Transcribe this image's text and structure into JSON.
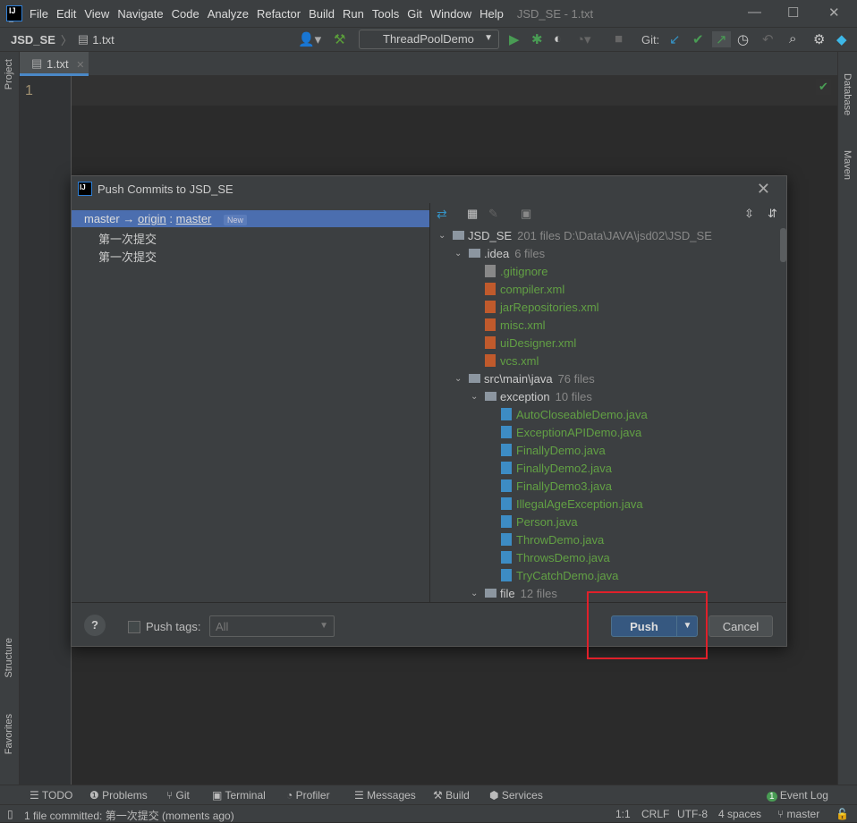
{
  "titlebar": {
    "menu": [
      "File",
      "Edit",
      "View",
      "Navigate",
      "Code",
      "Analyze",
      "Refactor",
      "Build",
      "Run",
      "Tools",
      "Git",
      "Window",
      "Help"
    ],
    "title": "JSD_SE - 1.txt"
  },
  "toolbar": {
    "project": "JSD_SE",
    "file": "1.txt",
    "run_config": "ThreadPoolDemo",
    "git_label": "Git:"
  },
  "side": {
    "left_top": "Project",
    "left_structure": "Structure",
    "left_favorites": "Favorites",
    "right_database": "Database",
    "right_maven": "Maven"
  },
  "editor": {
    "tab": "1.txt",
    "line": "1"
  },
  "dialog": {
    "title": "Push Commits to JSD_SE",
    "branch": {
      "local": "master",
      "arrow": "→",
      "remote": "origin",
      "sep": ":",
      "target": "master",
      "badge": "New"
    },
    "commits": [
      "第一次提交",
      "第一次提交"
    ],
    "tree": [
      {
        "level": 0,
        "type": "folder",
        "name": "JSD_SE",
        "info": "201 files  D:\\Data\\JAVA\\jsd02\\JSD_SE",
        "expanded": true
      },
      {
        "level": 1,
        "type": "folder",
        "name": ".idea",
        "info": "6 files",
        "expanded": true
      },
      {
        "level": 2,
        "type": "git",
        "name": ".gitignore"
      },
      {
        "level": 2,
        "type": "xml",
        "name": "compiler.xml"
      },
      {
        "level": 2,
        "type": "xml",
        "name": "jarRepositories.xml"
      },
      {
        "level": 2,
        "type": "xml",
        "name": "misc.xml"
      },
      {
        "level": 2,
        "type": "xml",
        "name": "uiDesigner.xml"
      },
      {
        "level": 2,
        "type": "xml",
        "name": "vcs.xml"
      },
      {
        "level": 1,
        "type": "folder",
        "name": "src\\main\\java",
        "info": "76 files",
        "expanded": true
      },
      {
        "level": 2,
        "type": "folder",
        "name": "exception",
        "info": "10 files",
        "expanded": true
      },
      {
        "level": 3,
        "type": "java",
        "name": "AutoCloseableDemo.java"
      },
      {
        "level": 3,
        "type": "java",
        "name": "ExceptionAPIDemo.java"
      },
      {
        "level": 3,
        "type": "java",
        "name": "FinallyDemo.java"
      },
      {
        "level": 3,
        "type": "java",
        "name": "FinallyDemo2.java"
      },
      {
        "level": 3,
        "type": "java",
        "name": "FinallyDemo3.java"
      },
      {
        "level": 3,
        "type": "java",
        "name": "IllegalAgeException.java"
      },
      {
        "level": 3,
        "type": "java",
        "name": "Person.java"
      },
      {
        "level": 3,
        "type": "java",
        "name": "ThrowDemo.java"
      },
      {
        "level": 3,
        "type": "java",
        "name": "ThrowsDemo.java"
      },
      {
        "level": 3,
        "type": "java",
        "name": "TryCatchDemo.java"
      },
      {
        "level": 2,
        "type": "folder",
        "name": "file",
        "info": "12 files",
        "expanded": true
      }
    ],
    "push_tags_label": "Push tags:",
    "push_tags_checked": false,
    "push_tags_value": "All",
    "push_label": "Push",
    "cancel_label": "Cancel",
    "help": "?"
  },
  "toolwindows": [
    "TODO",
    "Problems",
    "Git",
    "Terminal",
    "Profiler",
    "Messages",
    "Build",
    "Services"
  ],
  "event_log": {
    "label": "Event Log",
    "count": "1"
  },
  "status": {
    "message": "1 file committed: 第一次提交 (moments ago)",
    "position": "1:1",
    "line_sep": "CRLF",
    "encoding": "UTF-8",
    "indent": "4 spaces",
    "branch": "master"
  },
  "colors": {
    "accent": "#4b6eaf",
    "push_button": "#365880",
    "highlight_box": "#e0202a",
    "vcs_added": "#62a044"
  }
}
